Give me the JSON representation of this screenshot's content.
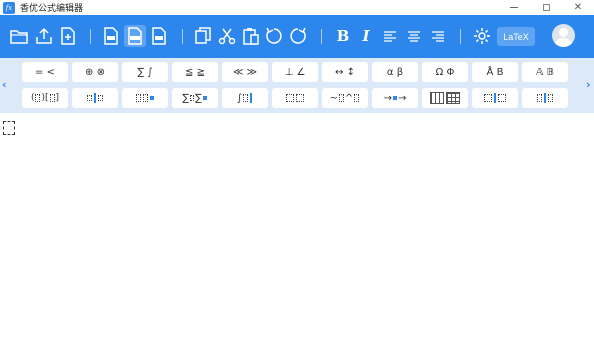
{
  "window": {
    "title": "香优公式编辑器",
    "app_icon_text": "fx",
    "close_glyph": "✕"
  },
  "toolbar": {
    "bold_label": "B",
    "italic_label": "I",
    "latex_label": "LaTeX",
    "accent_color": "#2c86ec"
  },
  "palette": {
    "nav_left": "‹",
    "nav_right": "›",
    "row1": [
      "= <",
      "⊕ ⊗",
      "∑ ∫",
      "≦ ≧",
      "≪ ≫",
      "⊥ ∠",
      "↔ ↕",
      "α β",
      "Ω Φ",
      "Å B",
      "𝔸 𝔹"
    ]
  }
}
